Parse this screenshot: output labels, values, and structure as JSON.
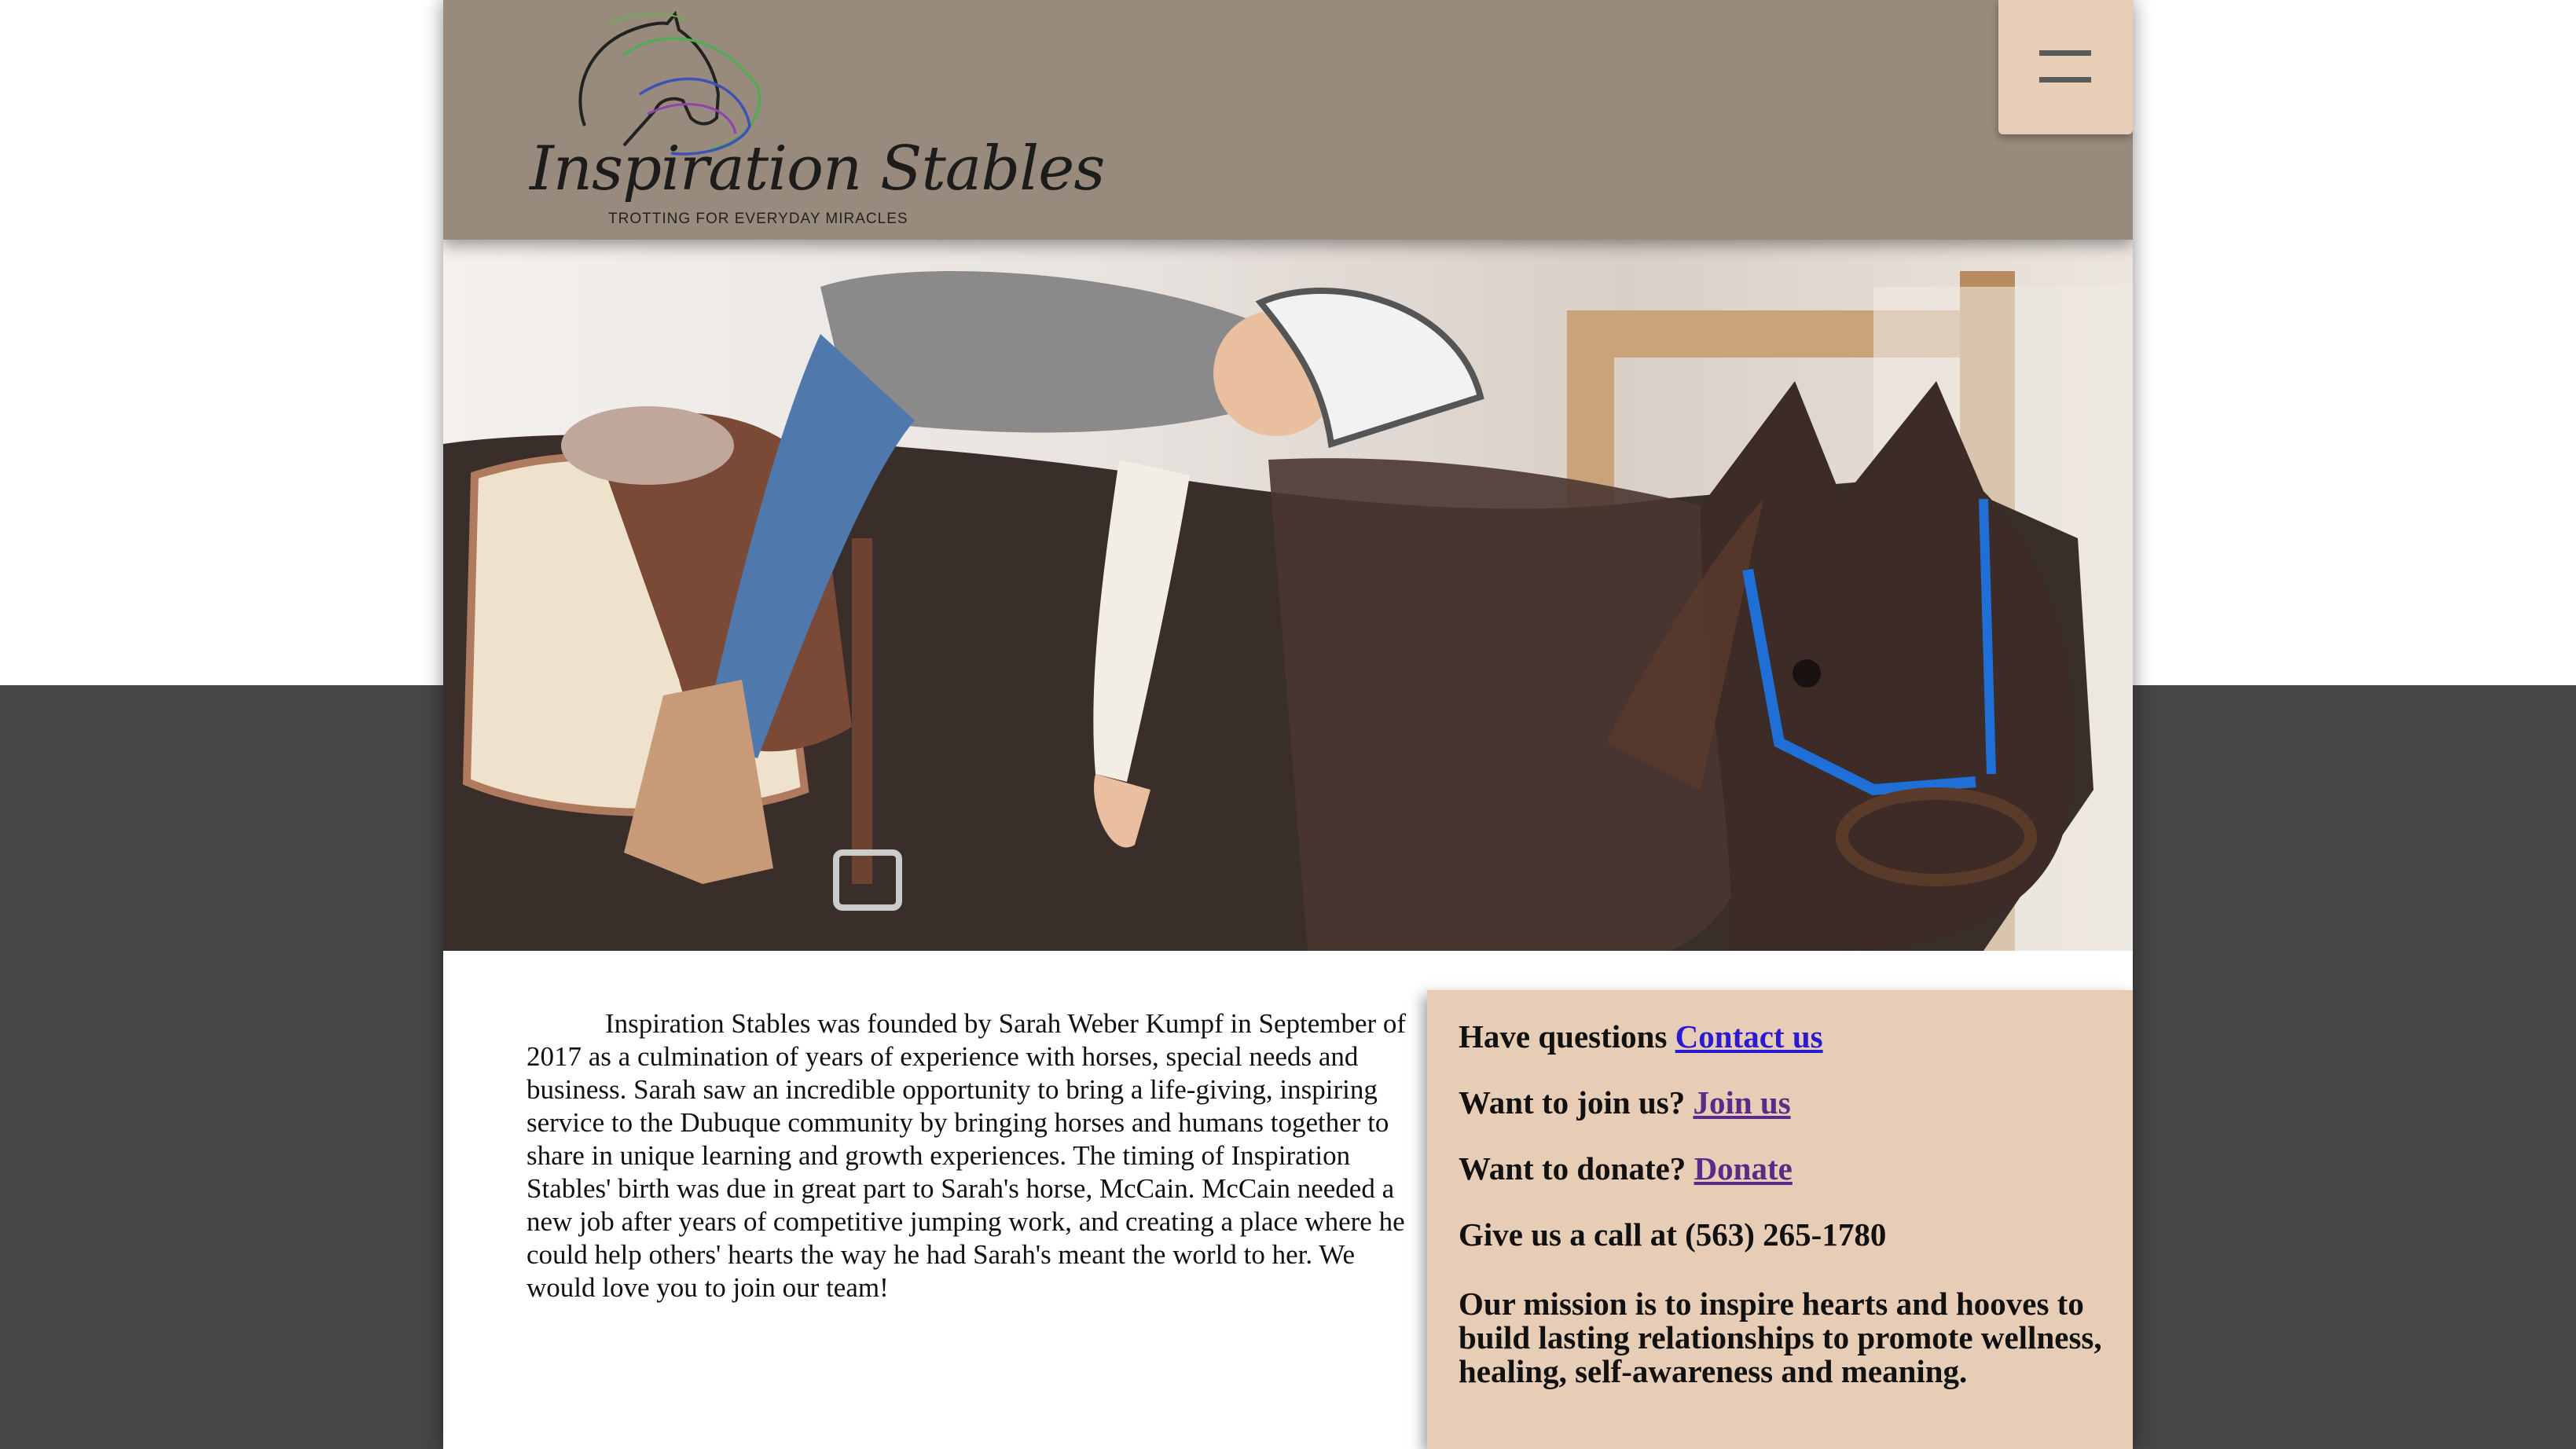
{
  "header": {
    "logo_name": "Inspiration Stables",
    "logo_tagline": "TROTTING FOR EVERYDAY MIRACLES",
    "menu_icon": "hamburger-menu-icon"
  },
  "hero": {
    "image_content": "photo"
  },
  "story": {
    "text": "Inspiration Stables was founded by Sarah Weber Kumpf in September of 2017 as a culmination of years of experience with horses, special needs and business. Sarah saw an incredible opportunity to bring a life-giving, inspiring service to the Dubuque community by bringing horses and humans together to share in unique learning and growth experiences. The timing of Inspiration Stables' birth was due in great part to Sarah's horse, McCain. McCain needed a new job after years of competitive jumping work, and creating a place where he could help others' hearts the way he had Sarah's meant the world to her. We would love you to join our team!"
  },
  "sidebar": {
    "questions_label": "Have questions",
    "contact_link": "Contact us",
    "join_label": "Want to join us?",
    "join_link": "Join us",
    "donate_label": "Want to donate?",
    "donate_link": "Donate",
    "call_text": "Give us a call at (563) 265-1780",
    "mission": "Our mission is to inspire hearts and hooves to build lasting relationships to promote wellness, healing, self-awareness and meaning."
  },
  "colors": {
    "header": "#988a7c",
    "accent": "#e8cdb6",
    "dark_band": "#464646",
    "link": "#2a1bd0",
    "visited_link": "#5b2a86"
  }
}
